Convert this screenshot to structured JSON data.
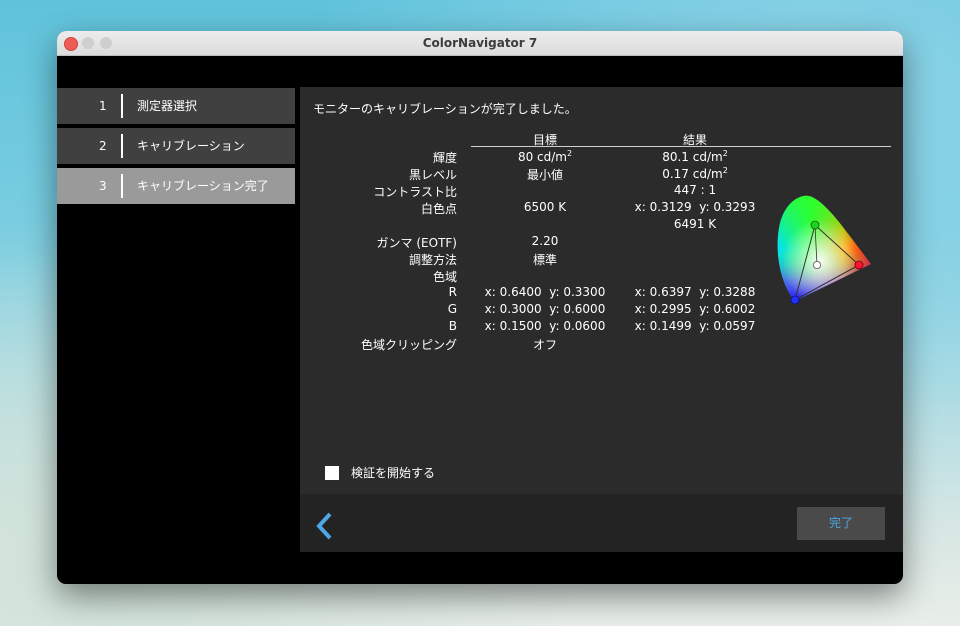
{
  "window": {
    "title": "ColorNavigator 7"
  },
  "steps": [
    {
      "num": "1",
      "label": "測定器選択"
    },
    {
      "num": "2",
      "label": "キャリブレーション"
    },
    {
      "num": "3",
      "label": "キャリブレーション完了"
    }
  ],
  "message": "モニターのキャリブレーションが完了しました。",
  "table": {
    "header_target": "目標",
    "header_result": "結果",
    "rows": {
      "luminance": {
        "label": "輝度",
        "target_value": "80 cd/m",
        "target_sup": "2",
        "result_value": "80.1 cd/m",
        "result_sup": "2"
      },
      "black": {
        "label": "黒レベル",
        "target": "最小値",
        "result_value": "0.17 cd/m",
        "result_sup": "2"
      },
      "contrast": {
        "label": "コントラスト比",
        "result": "447 : 1"
      },
      "white": {
        "label": "白色点",
        "target": "6500 K",
        "result_x": "x: 0.3129",
        "result_y": "y: 0.3293",
        "result_k": "6491 K"
      },
      "gamma": {
        "label": "ガンマ (EOTF)",
        "target": "2.20"
      },
      "method": {
        "label": "調整方法",
        "target": "標準"
      },
      "gamut": {
        "label": "色域"
      },
      "r": {
        "label": "R",
        "target_x": "x: 0.6400",
        "target_y": "y: 0.3300",
        "result_x": "x: 0.6397",
        "result_y": "y: 0.3288"
      },
      "g": {
        "label": "G",
        "target_x": "x: 0.3000",
        "target_y": "y: 0.6000",
        "result_x": "x: 0.2995",
        "result_y": "y: 0.6002"
      },
      "b": {
        "label": "B",
        "target_x": "x: 0.1500",
        "target_y": "y: 0.0600",
        "result_x": "x: 0.1499",
        "result_y": "y: 0.0597"
      },
      "clipping": {
        "label": "色域クリッピング",
        "target": "オフ"
      }
    }
  },
  "verify": {
    "label": "検証を開始する",
    "checked": false
  },
  "buttons": {
    "done": "完了"
  },
  "colors": {
    "accent": "#4ea6e6",
    "active_step": "#9a9a9a",
    "step": "#404040",
    "panel": "#2b2b2b"
  },
  "icons": {
    "back": "chevron-left-icon",
    "gamut": "cie-gamut-diagram-icon"
  }
}
